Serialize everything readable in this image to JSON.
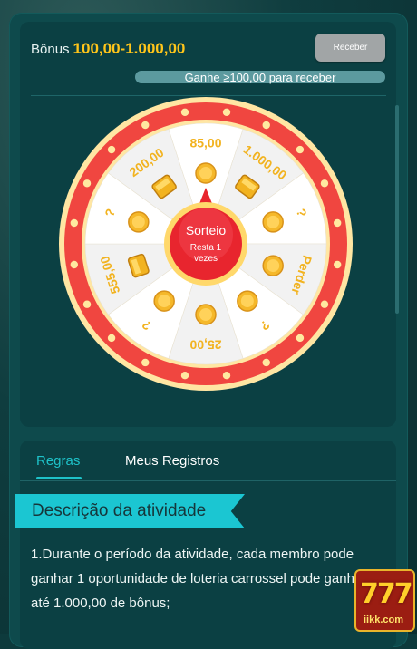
{
  "bonus": {
    "label": "Bônus",
    "amount": "100,00-1.000,00",
    "receive_label": "Receber",
    "progress_text": "Ganhe ≥100,00 para receber"
  },
  "wheel": {
    "segments": [
      {
        "label": "85,00",
        "icon": "coin-icon"
      },
      {
        "label": "1.000,00",
        "icon": "gold-chest-icon"
      },
      {
        "label": "?",
        "icon": "coin-icon"
      },
      {
        "label": "Perder",
        "icon": "coin-icon"
      },
      {
        "label": "?",
        "icon": "coin-icon"
      },
      {
        "label": "25,00",
        "icon": "coin-icon"
      },
      {
        "label": "?",
        "icon": "coin-icon"
      },
      {
        "label": "555,00",
        "icon": "gold-chest-icon"
      },
      {
        "label": "?",
        "icon": "coin-icon"
      },
      {
        "label": "200,00",
        "icon": "gold-chest-icon"
      }
    ],
    "center_title": "Sorteio",
    "center_sub1": "Resta",
    "center_count": "1",
    "center_sub2": "vezes",
    "colors": {
      "rim": "#f04640",
      "rim_border": "#ffe6a3",
      "seg_a": "#ffffff",
      "seg_b": "#f2f2f2",
      "label": "#f2b320",
      "hub": "#e8252e"
    }
  },
  "tabs": [
    {
      "label": "Regras",
      "active": true
    },
    {
      "label": "Meus Registros",
      "active": false
    }
  ],
  "description": {
    "title": "Descrição da atividade",
    "rule_1": "1.Durante o período da atividade, cada membro pode ganhar 1 oportunidade de loteria carrossel pode ganhar até 1.000,00 de bônus;"
  },
  "logo": {
    "text": "777",
    "brand": "iikk.com"
  }
}
